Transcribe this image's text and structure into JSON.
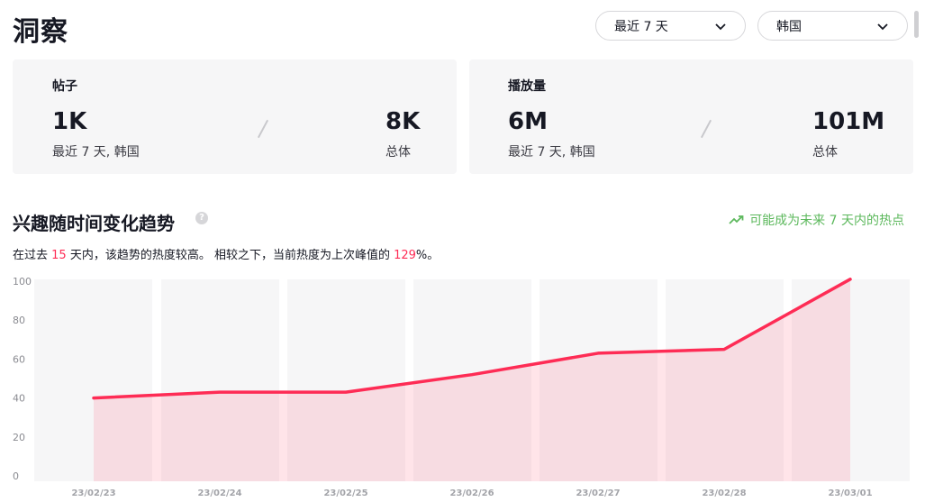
{
  "header": {
    "title": "洞察",
    "period_select": "最近 7 天",
    "region_select": "韩国"
  },
  "cards": {
    "posts": {
      "label": "帖子",
      "recent_value": "1K",
      "recent_caption": "最近 7 天, 韩国",
      "total_value": "8K",
      "total_caption": "总体"
    },
    "views": {
      "label": "播放量",
      "recent_value": "6M",
      "recent_caption": "最近 7 天, 韩国",
      "total_value": "101M",
      "total_caption": "总体"
    }
  },
  "trend": {
    "title": "兴趣随时间变化趋势",
    "help": "?",
    "hot_hint": "可能成为未来 7 天内的热点",
    "summary_pre": "在过去 ",
    "summary_days": "15",
    "summary_mid": " 天内，该趋势的热度较高。 相较之下，当前热度为上次峰值的 ",
    "summary_pct": "129",
    "summary_post": "%。"
  },
  "colors": {
    "accent": "#fe2c55",
    "hint_green": "#5cb85c",
    "card_bg": "#f6f6f7"
  },
  "chart_data": {
    "type": "area",
    "categories": [
      "23/02/23",
      "23/02/24",
      "23/02/25",
      "23/02/26",
      "23/02/27",
      "23/02/28",
      "23/03/01"
    ],
    "values": [
      40,
      43,
      43,
      52,
      63,
      65,
      101
    ],
    "yticks": [
      0,
      20,
      40,
      60,
      80,
      100
    ],
    "ylim": [
      0,
      100
    ],
    "grid": false,
    "color": "#fe2c55"
  }
}
